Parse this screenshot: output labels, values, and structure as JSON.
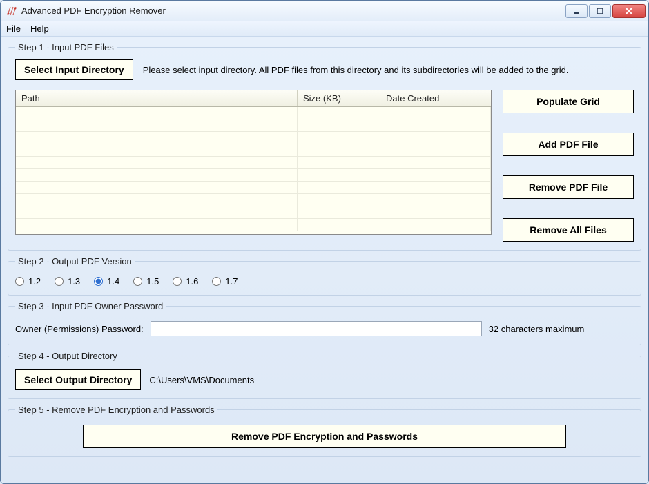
{
  "title": "Advanced PDF Encryption Remover",
  "menu": {
    "file": "File",
    "help": "Help"
  },
  "step1": {
    "legend": "Step 1 - Input PDF Files",
    "select_input_dir": "Select Input Directory",
    "hint": "Please select input directory. All PDF files from this directory and its subdirectories will be added to the grid.",
    "cols": {
      "path": "Path",
      "size": "Size (KB)",
      "date": "Date Created"
    },
    "buttons": {
      "populate": "Populate Grid",
      "add": "Add PDF File",
      "remove": "Remove PDF File",
      "remove_all": "Remove All Files"
    },
    "rows": []
  },
  "step2": {
    "legend": "Step 2 - Output PDF Version",
    "options": [
      "1.2",
      "1.3",
      "1.4",
      "1.5",
      "1.6",
      "1.7"
    ],
    "selected": "1.4"
  },
  "step3": {
    "legend": "Step 3 - Input PDF Owner Password",
    "label": "Owner (Permissions) Password:",
    "value": "",
    "note": "32 characters maximum"
  },
  "step4": {
    "legend": "Step 4 - Output Directory",
    "select_output_dir": "Select Output Directory",
    "path": "C:\\Users\\VMS\\Documents"
  },
  "step5": {
    "legend": "Step 5 - Remove PDF Encryption and Passwords",
    "action": "Remove PDF Encryption and Passwords"
  }
}
